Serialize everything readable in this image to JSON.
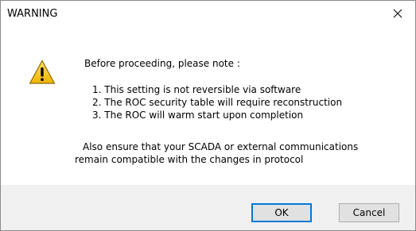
{
  "window": {
    "title": "WARNING",
    "close_icon": "close-icon"
  },
  "message": {
    "icon": "warning-triangle-icon",
    "heading": "Before proceeding, please note :",
    "items": [
      "1. This setting is not reversible via software",
      "2. The ROC security table will require reconstruction",
      "3. The ROC will warm start upon completion"
    ],
    "also_line1": "Also ensure that your SCADA or external communications",
    "also_line2": "remain compatible with the changes in protocol"
  },
  "buttons": {
    "ok_label": "OK",
    "cancel_label": "Cancel"
  },
  "colors": {
    "focus_border": "#0078d7",
    "footer_background": "#f0f0f0",
    "warning_yellow": "#f5c400"
  }
}
